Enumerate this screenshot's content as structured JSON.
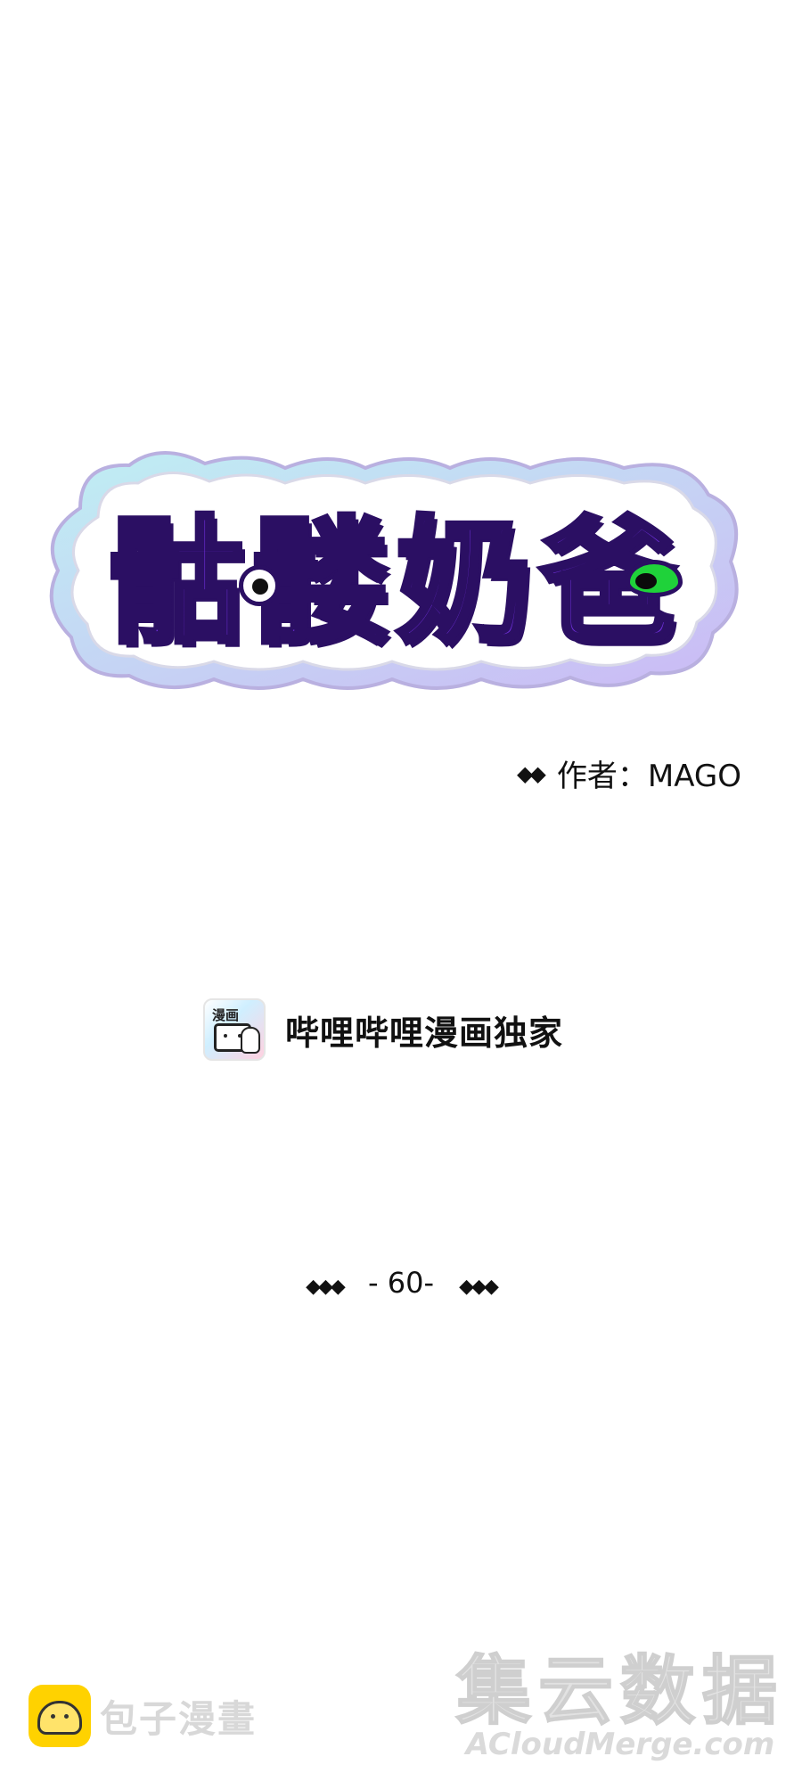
{
  "title": {
    "logo_text": "骷髅奶爸"
  },
  "author": {
    "decor": "◆◆",
    "label": "作者：MAGO"
  },
  "exclusive": {
    "icon_char": "漫画",
    "text": "哔哩哔哩漫画独家"
  },
  "chapter": {
    "decor_left": "◆◆◆",
    "number": "- 60-",
    "decor_right": "◆◆◆"
  },
  "watermarks": {
    "baozi_text": "包子漫畫",
    "acm_cn": "集云数据",
    "acm_en": "ACloudMerge.com"
  },
  "colors": {
    "logo_purple": "#6d2fd6",
    "logo_outline": "#2b0f63",
    "eye_green": "#1fd23a",
    "background": "#ffffff"
  }
}
